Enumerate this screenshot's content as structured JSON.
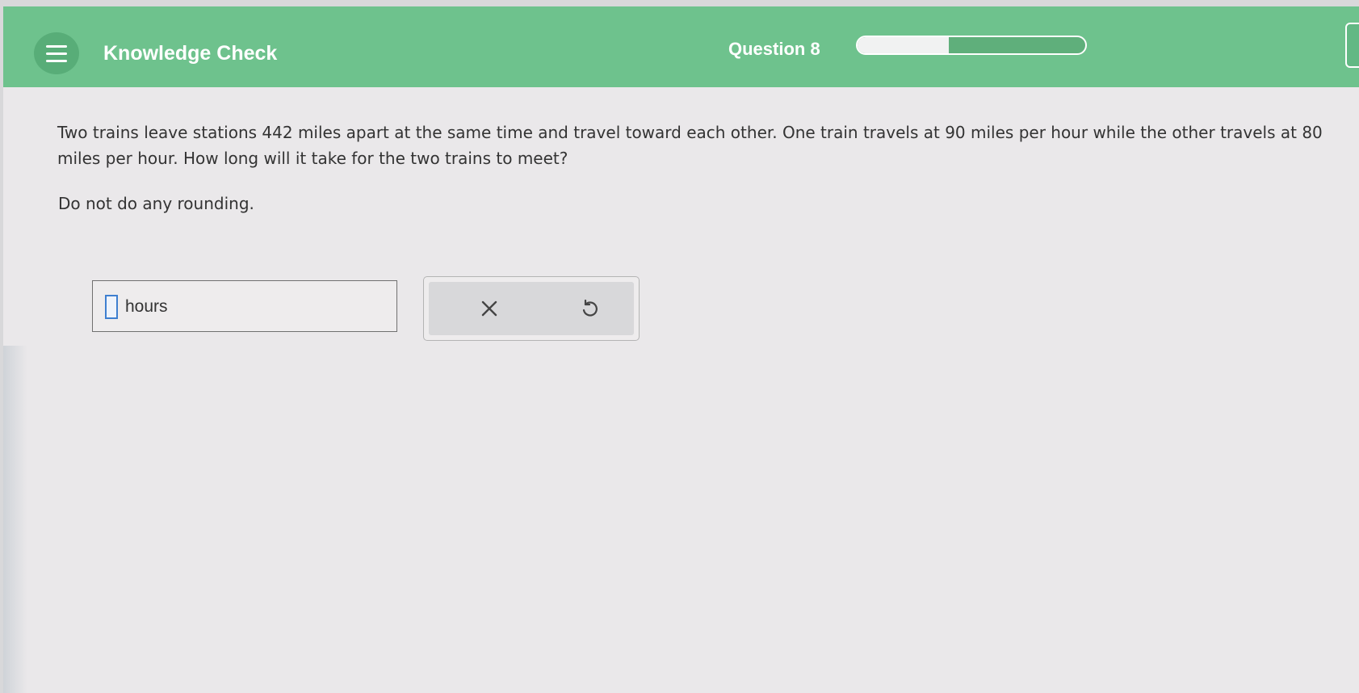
{
  "header": {
    "title": "Knowledge Check",
    "question_label": "Question 8",
    "progress_fraction": 0.4,
    "background_color": "#6ec28d",
    "menu_icon": "hamburger-menu-icon"
  },
  "problem": {
    "text": "Two trains leave stations 442 miles apart at the same time and travel toward each other. One train travels at 90 miles per hour while the other travels at 80 miles per hour. How long will it take for the two trains to meet?",
    "instruction": "Do not do any rounding."
  },
  "answer": {
    "value": "",
    "unit": "hours"
  },
  "actions": {
    "clear_icon": "close-x-icon",
    "undo_icon": "undo-icon"
  }
}
